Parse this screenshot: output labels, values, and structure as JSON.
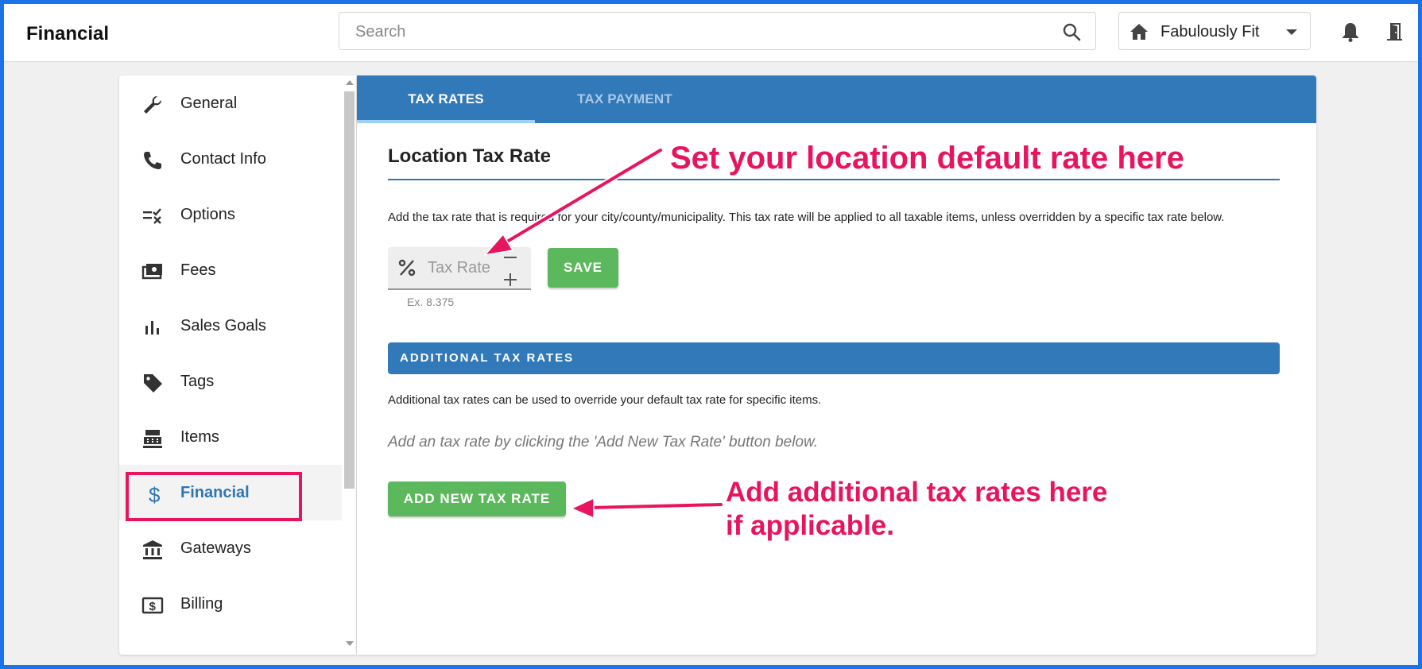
{
  "header": {
    "app_title": "Financial",
    "search_placeholder": "Search",
    "location": "Fabulously Fit",
    "icons": [
      "search-icon",
      "home-icon",
      "chevron-down-icon",
      "bell-icon",
      "exit-door-icon"
    ]
  },
  "sidebar": {
    "items": [
      {
        "label": "General",
        "icon": "wrench-icon"
      },
      {
        "label": "Contact Info",
        "icon": "phone-icon"
      },
      {
        "label": "Options",
        "icon": "options-checklist-icon"
      },
      {
        "label": "Fees",
        "icon": "fees-money-icon"
      },
      {
        "label": "Sales Goals",
        "icon": "bar-chart-icon"
      },
      {
        "label": "Tags",
        "icon": "tag-icon"
      },
      {
        "label": "Items",
        "icon": "cash-register-icon"
      },
      {
        "label": "Financial",
        "icon": "dollar-icon",
        "active": true
      },
      {
        "label": "Gateways",
        "icon": "bank-icon"
      },
      {
        "label": "Billing",
        "icon": "billing-icon"
      }
    ]
  },
  "tabs": [
    {
      "label": "TAX RATES",
      "active": true
    },
    {
      "label": "TAX PAYMENT",
      "active": false
    }
  ],
  "location_tax": {
    "title": "Location Tax Rate",
    "description": "Add the tax rate that is required for your city/county/municipality. This tax rate will be applied to all taxable items, unless overridden by a specific tax rate below.",
    "rate_placeholder": "Tax Rate",
    "hint": "Ex. 8.375",
    "save_label": "SAVE"
  },
  "additional": {
    "header": "ADDITIONAL TAX RATES",
    "description": "Additional tax rates can be used to override your default tax rate for specific items.",
    "empty_message": "Add an tax rate by clicking the 'Add New Tax Rate' button below.",
    "add_button": "ADD NEW TAX RATE"
  },
  "annotations": {
    "top": "Set your location default rate here",
    "bottom_line1": "Add additional tax rates here",
    "bottom_line2": "if applicable."
  },
  "colors": {
    "primary": "#3179b8",
    "success": "#5cb85c",
    "annotation": "#e8145f",
    "frame": "#1a73e8"
  }
}
